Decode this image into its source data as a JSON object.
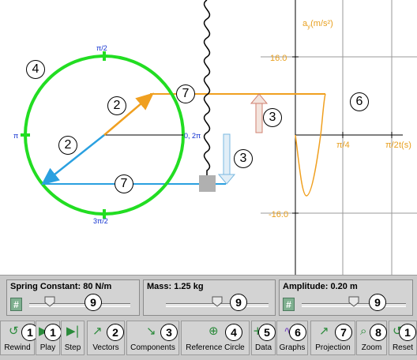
{
  "graph": {
    "y_axis_label": "a",
    "y_axis_label_sub": "y",
    "y_axis_unit": "(m/s²)",
    "x_axis_unit": "t(s)",
    "tick_top": "16.0",
    "tick_bottom": "-16.0",
    "tick_x1": "π/4",
    "tick_x2": "π/2"
  },
  "circle": {
    "label_top": "π/2",
    "label_left": "π",
    "label_right": "0, 2π",
    "label_bottom": "3π/2"
  },
  "stage_markers": [
    "4",
    "2",
    "2",
    "7",
    "7",
    "3",
    "3",
    "6"
  ],
  "sliders": [
    {
      "label": "Spring Constant: 80 N/m",
      "hash": "#",
      "marker": "9",
      "value_fraction": 0.2
    },
    {
      "label": "Mass: 1.25 kg",
      "hash": "#",
      "marker": "9",
      "value_fraction": 0.5
    },
    {
      "label": "Amplitude: 0.20 m",
      "hash": "#",
      "marker": "9",
      "value_fraction": 0.5
    }
  ],
  "toolbar": {
    "rewind": {
      "label": "Rewind",
      "marker": "1"
    },
    "play": {
      "label": "Play",
      "marker": "1"
    },
    "step": {
      "label": "Step"
    },
    "vectors": {
      "label": "Vectors",
      "marker": "2"
    },
    "components": {
      "label": "Components",
      "marker": "3"
    },
    "reference_circle": {
      "label": "Reference Circle",
      "marker": "4"
    },
    "data": {
      "label": "Data",
      "marker": "5"
    },
    "graphs": {
      "label": "Graphs",
      "marker": "6"
    },
    "projection": {
      "label": "Projection",
      "marker": "7"
    },
    "zoom": {
      "label": "Zoom",
      "marker": "8"
    },
    "reset": {
      "label": "Reset",
      "marker": "1"
    }
  },
  "colors": {
    "circle": "#22dd22",
    "vector_orange": "#f0a020",
    "vector_blue": "#2aa0e0",
    "graph_curve": "#f0a020",
    "axis_label": "#e8a020",
    "tick_label_circle": "#1030d0"
  }
}
